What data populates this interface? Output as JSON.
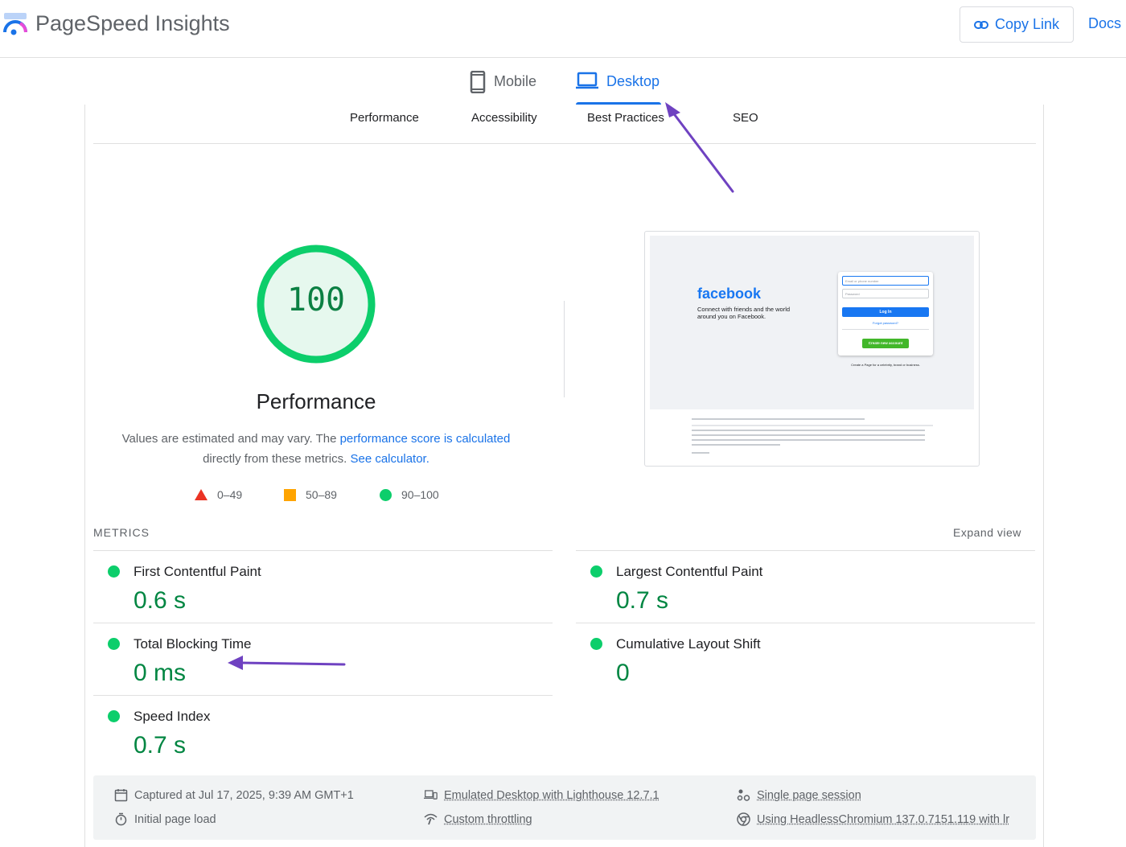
{
  "header": {
    "app_title": "PageSpeed Insights",
    "copy_link_label": "Copy Link",
    "docs_label": "Docs"
  },
  "device_tabs": [
    {
      "label": "Mobile",
      "selected": false
    },
    {
      "label": "Desktop",
      "selected": true
    }
  ],
  "category_tabs": [
    "Performance",
    "Accessibility",
    "Best Practices",
    "SEO"
  ],
  "score": {
    "value": "100",
    "label": "Performance",
    "description_prefix": "Values are estimated and may vary. The ",
    "description_link1": "performance score is calculated",
    "description_middle": " directly from these metrics. ",
    "description_link2": "See calculator.",
    "color": "#0cce6b"
  },
  "legend": [
    {
      "shape": "triangle",
      "range": "0–49",
      "color": "#eb3324"
    },
    {
      "shape": "square",
      "range": "50–89",
      "color": "#ffa400"
    },
    {
      "shape": "circle",
      "range": "90–100",
      "color": "#0cce6b"
    }
  ],
  "screenshot": {
    "brand": "facebook",
    "tagline": "Connect with friends and the world around you on Facebook.",
    "email_placeholder": "Email or phone number",
    "password_placeholder": "Password",
    "login_label": "Log In",
    "forgot_label": "Forgot password?",
    "create_label": "Create new account",
    "page_text": "Create a Page for a celebrity, brand or business."
  },
  "metrics_section": {
    "heading": "METRICS",
    "expand_label": "Expand view",
    "items": [
      {
        "name": "First Contentful Paint",
        "value": "0.6 s"
      },
      {
        "name": "Largest Contentful Paint",
        "value": "0.7 s"
      },
      {
        "name": "Total Blocking Time",
        "value": "0 ms"
      },
      {
        "name": "Cumulative Layout Shift",
        "value": "0"
      },
      {
        "name": "Speed Index",
        "value": "0.7 s"
      }
    ]
  },
  "footer": {
    "captured": "Captured at Jul 17, 2025, 9:39 AM GMT+1",
    "initial_load": "Initial page load",
    "emulated": "Emulated Desktop with Lighthouse 12.7.1",
    "throttling": "Custom throttling",
    "session": "Single page session",
    "browser": "Using HeadlessChromium 137.0.7151.119 with lr"
  },
  "colors": {
    "accent": "#1a73e8",
    "good": "#0cce6b",
    "good_text": "#018642",
    "annotation_arrow": "#6f42c1"
  }
}
